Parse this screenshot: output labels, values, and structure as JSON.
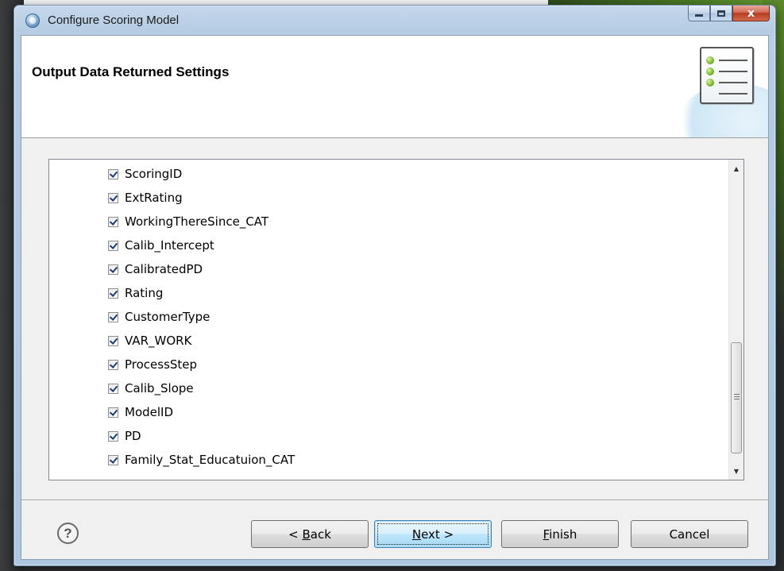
{
  "window": {
    "title": "Configure Scoring Model",
    "controls": {
      "minimize": "minimize",
      "maximize": "maximize",
      "close": "x"
    }
  },
  "header": {
    "title": "Output Data Returned Settings",
    "icon": "checklist-icon"
  },
  "fields": [
    {
      "label": "ScoringID",
      "checked": true
    },
    {
      "label": "ExtRating",
      "checked": true
    },
    {
      "label": "WorkingThereSince_CAT",
      "checked": true
    },
    {
      "label": "Calib_Intercept",
      "checked": true
    },
    {
      "label": "CalibratedPD",
      "checked": true
    },
    {
      "label": "Rating",
      "checked": true
    },
    {
      "label": "CustomerType",
      "checked": true
    },
    {
      "label": "VAR_WORK",
      "checked": true
    },
    {
      "label": "ProcessStep",
      "checked": true
    },
    {
      "label": "Calib_Slope",
      "checked": true
    },
    {
      "label": "ModelID",
      "checked": true
    },
    {
      "label": "PD",
      "checked": true
    },
    {
      "label": "Family_Stat_Educatuion_CAT",
      "checked": true
    }
  ],
  "buttons": {
    "help": "?",
    "back": {
      "prefix": "< ",
      "mnemonic": "B",
      "rest": "ack"
    },
    "next": {
      "mnemonic": "N",
      "rest": "ext >"
    },
    "finish": {
      "mnemonic": "F",
      "rest": "inish"
    },
    "cancel": "Cancel"
  },
  "colors": {
    "default_button_border": "#3c7fb1",
    "close_button": "#c84a30",
    "check_mark": "#1a3d74"
  }
}
